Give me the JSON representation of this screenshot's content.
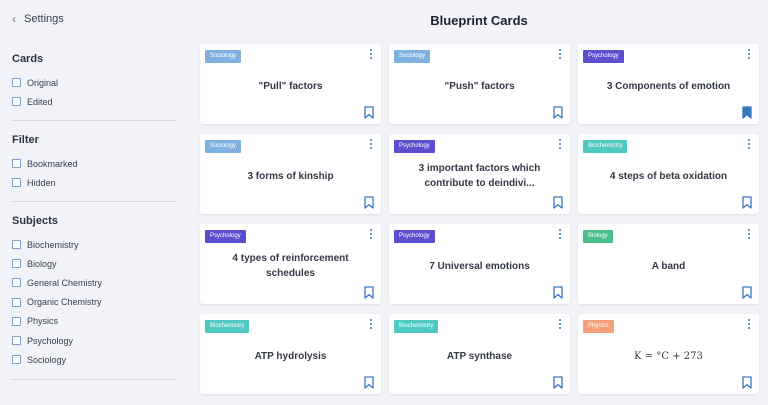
{
  "sidebar": {
    "settings_label": "Settings",
    "sections": [
      {
        "title": "Cards",
        "options": [
          "Original",
          "Edited"
        ]
      },
      {
        "title": "Filter",
        "options": [
          "Bookmarked",
          "Hidden"
        ]
      },
      {
        "title": "Subjects",
        "options": [
          "Biochemistry",
          "Biology",
          "General Chemistry",
          "Organic Chemistry",
          "Physics",
          "Psychology",
          "Sociology"
        ]
      }
    ]
  },
  "main": {
    "title": "Blueprint Cards"
  },
  "colors": {
    "Sociology": "#7fb1e0",
    "Psychology": "#5b4fcf",
    "Biochemistry": "#4fcac2",
    "Biology": "#4cbf88",
    "Physics": "#f5a07a",
    "accent": "#3a77bf"
  },
  "cards": [
    {
      "tag": "Sociology",
      "title": "\"Pull\" factors",
      "bookmarked": false
    },
    {
      "tag": "Sociology",
      "title": "\"Push\" factors",
      "bookmarked": false
    },
    {
      "tag": "Psychology",
      "title": "3 Components of emotion",
      "bookmarked": true
    },
    {
      "tag": "Sociology",
      "title": "3 forms of kinship",
      "bookmarked": false
    },
    {
      "tag": "Psychology",
      "title": "3 important factors which contribute to deindivi...",
      "bookmarked": false
    },
    {
      "tag": "Biochemistry",
      "title": "4 steps of beta oxidation",
      "bookmarked": false
    },
    {
      "tag": "Psychology",
      "title": "4 types of reinforcement schedules",
      "bookmarked": false
    },
    {
      "tag": "Psychology",
      "title": "7 Universal emotions",
      "bookmarked": false
    },
    {
      "tag": "Biology",
      "title": "A band",
      "bookmarked": false
    },
    {
      "tag": "Biochemistry",
      "title": "ATP hydrolysis",
      "bookmarked": false
    },
    {
      "tag": "Biochemistry",
      "title": "ATP synthase",
      "bookmarked": false
    },
    {
      "tag": "Physics",
      "title": "K = °C + 273",
      "bookmarked": false,
      "math": true
    }
  ]
}
